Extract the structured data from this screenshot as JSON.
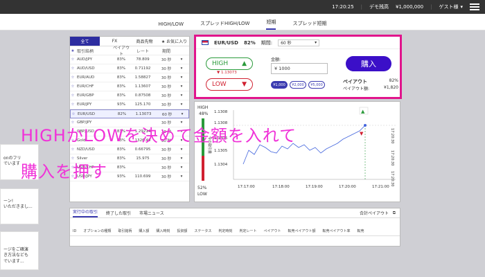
{
  "topbar": {
    "time": "17:20:25",
    "demo_label": "デモ残高",
    "balance": "¥1,000,000",
    "user": "ゲスト様"
  },
  "mode_tabs": [
    "HIGH/LOW",
    "スプレッドHIGH/LOW",
    "短期",
    "スプレッド短期"
  ],
  "mode_active": 2,
  "left_notices": [
    "onのフリ\nでいます",
    "ーン!\nいただきまし...",
    "ージをご確演\nき方法なども\nでいます..."
  ],
  "asset_tabs": [
    "全て",
    "FX",
    "商品先物",
    "★ お気に入り"
  ],
  "asset_headers": {
    "star": "★",
    "name": "取引銘柄",
    "payout": "ペイアウト",
    "rate": "レート",
    "period": "期間"
  },
  "assets": [
    {
      "name": "AUD/JPY",
      "payout": "83%",
      "rate": "78.809",
      "period": "30 秒"
    },
    {
      "name": "AUD/USD",
      "payout": "83%",
      "rate": "0.71192",
      "period": "30 秒"
    },
    {
      "name": "EUR/AUD",
      "payout": "83%",
      "rate": "1.58827",
      "period": "30 秒"
    },
    {
      "name": "EUR/CHF",
      "payout": "83%",
      "rate": "1.13607",
      "period": "30 秒"
    },
    {
      "name": "EUR/GBP",
      "payout": "83%",
      "rate": "0.87508",
      "period": "30 秒"
    },
    {
      "name": "EUR/JPY",
      "payout": "93%",
      "rate": "125.170",
      "period": "30 秒"
    },
    {
      "name": "EUR/USD",
      "payout": "82%",
      "rate": "1.13073",
      "period": "60 秒",
      "selected": true
    },
    {
      "name": "GBP/JPY",
      "payout": "",
      "rate": "",
      "period": "30 秒"
    },
    {
      "name": "GBP/USD",
      "payout": "83%",
      "rate": "1.29214",
      "period": "30 秒"
    },
    {
      "name": "Gold",
      "payout": "83%",
      "rate": "1326.40",
      "period": "30 秒"
    },
    {
      "name": "NZD/USD",
      "payout": "83%",
      "rate": "0.66795",
      "period": "30 秒"
    },
    {
      "name": "Silver",
      "payout": "83%",
      "rate": "15.975",
      "period": "30 秒"
    },
    {
      "name": "USD/CHF",
      "payout": "83%",
      "rate": "",
      "period": "30 秒"
    },
    {
      "name": "USD/JPY",
      "payout": "93%",
      "rate": "110.699",
      "period": "30 秒"
    }
  ],
  "order": {
    "pair": "EUR/USD",
    "payout": "82%",
    "period_label": "期間:",
    "period_value": "60 秒",
    "high_label": "HIGH",
    "low_label": "LOW",
    "low_rate": "▼ 1.13073",
    "amount_label": "金額:",
    "amount_value": "¥ 1000",
    "chips": [
      "¥1,000",
      "¥2,000",
      "¥5,000"
    ],
    "buy_label": "購入",
    "payout_title": "ペイアウト",
    "payout_rate": "82%",
    "payout_amount_label": "ペイアウト額:",
    "payout_amount": "¥1,820"
  },
  "chart": {
    "high_label": "HIGH",
    "high_pct": "48%",
    "low_pct": "52%",
    "low_label": "LOW",
    "vertical_label": "今の取引量",
    "y_ticks": [
      "1.1308",
      "1.1306",
      "1.1305",
      "1.1304"
    ],
    "x_ticks": [
      "17:17:00",
      "17:18:00",
      "17:19:00",
      "17:20:00",
      "17:21:00"
    ],
    "side_labels": [
      "17:20:30",
      "17:20:30",
      "17:20:30"
    ]
  },
  "bottom": {
    "tabs": [
      "実行中の取引",
      "終了した取引",
      "市場ニュース"
    ],
    "total_payout": "合計ペイアウト",
    "columns": [
      "ID",
      "オプションの種類",
      "取引銘柄",
      "購入額",
      "購入時刻",
      "投資額",
      "ステータス",
      "判定時刻",
      "判定レート",
      "ペイアウト",
      "転売ペイアウト額",
      "転売ペイアウト率",
      "転売"
    ]
  },
  "overlay": {
    "line1": "HIGHかLOWを決めて金額を入れて",
    "line2": "購入を押す"
  }
}
